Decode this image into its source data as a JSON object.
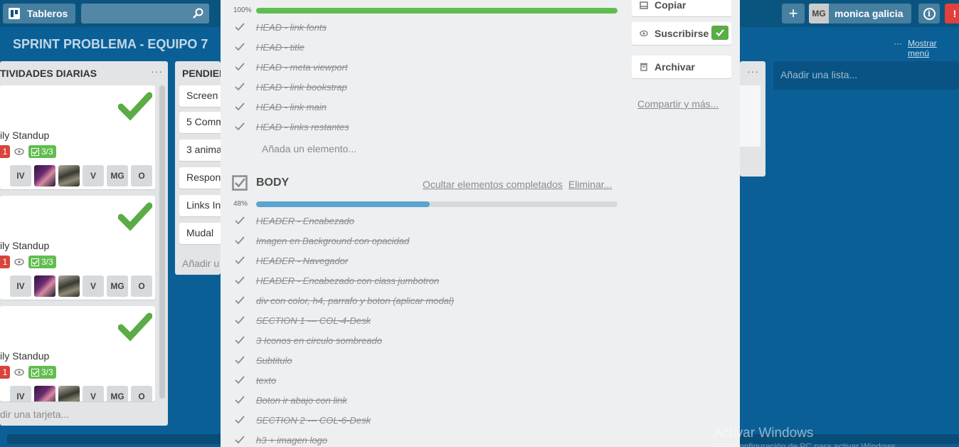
{
  "topbar": {
    "boards_label": "Tableros",
    "search_placeholder": "",
    "add_label": "+",
    "user_initials": "MG",
    "user_name": "monica galicia",
    "info_label": "i",
    "notification_label": "!"
  },
  "board": {
    "title": "SPRINT PROBLEMA - EQUIPO 7",
    "menu_dots": "···",
    "menu_label": "Mostrar menú"
  },
  "lists": {
    "daily": {
      "title": "TIVIDADES DIARIAS",
      "dots": "···",
      "cards": [
        {
          "title": "ily Standup",
          "red_badge": "1",
          "checklist": "3/3",
          "members": [
            "IV",
            "",
            "",
            "V",
            "MG",
            "O"
          ]
        },
        {
          "title": "ily Standup",
          "red_badge": "1",
          "checklist": "3/3",
          "members": [
            "IV",
            "",
            "",
            "V",
            "MG",
            "O"
          ]
        },
        {
          "title": "ily Standup",
          "red_badge": "1",
          "checklist": "3/3",
          "members": [
            "IV",
            "",
            "",
            "V",
            "MG",
            "O"
          ]
        }
      ],
      "add_card": "dir una tarjeta..."
    },
    "pending": {
      "title": "PENDIEN",
      "cards": [
        "Screen",
        "5 Comm",
        "3 anima",
        "Respon",
        "Links In",
        "Mudal"
      ],
      "add_card": "Añadir u"
    },
    "third": {
      "dots": "···"
    },
    "add_list": "Añadir una lista..."
  },
  "modal": {
    "head_checklist": {
      "percent": "100%",
      "progress": 100,
      "items": [
        "HEAD - link fonts",
        "HEAD - title",
        "HEAD - meta viewport",
        "HEAD - link bookstrap",
        "HEAD - link main",
        "HEAD - links restantes"
      ],
      "add_item": "Añada un elemento..."
    },
    "body_checklist": {
      "title": "BODY",
      "hide_completed": "Ocultar elementos completados",
      "delete": "Eliminar...",
      "percent": "48%",
      "progress": 48,
      "items": [
        "HEADER - Encabezado",
        "Imagen en Background con opacidad",
        "HEADER - Navegador",
        "HEADER - Encabezado con class jumbotron",
        "div con color, h4, parrafo y boton (aplicar modal)",
        "SECTION 1 --- COL-4-Desk",
        "3 Iconos en circulo sombreado",
        "Subtitulo",
        "texto",
        "Boton ir abajo con link",
        "SECTION 2 --- COL-6-Desk",
        "h3 + imagen logo"
      ]
    },
    "sidebar": {
      "copy": "Copiar",
      "subscribe": "Suscribirse",
      "archive": "Archivar",
      "share": "Compartir y más..."
    }
  },
  "windows": {
    "activate": "Activar Windows",
    "sub": "Ve a Configuración de PC para activar Windows."
  },
  "colors": {
    "board_bg": "#0a5f97",
    "progress_complete": "#61bd4f",
    "progress_partial": "#5ba4cf"
  }
}
